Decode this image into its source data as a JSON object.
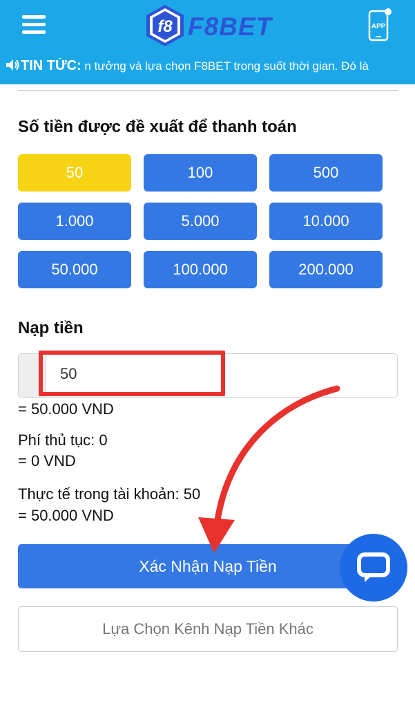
{
  "header": {
    "brand": "F8BET",
    "logo_mark": "f8",
    "app_label": "APP",
    "ticker_label": "TIN TỨC:",
    "ticker_text": " n tưởng và lựa chọn F8BET trong suốt thời gian. Đó là"
  },
  "suggested": {
    "title": "Số tiền được đề xuất để thanh toán",
    "amounts": [
      "50",
      "100",
      "500",
      "1.000",
      "5.000",
      "10.000",
      "50.000",
      "100.000",
      "200.000"
    ],
    "selected_index": 0
  },
  "deposit": {
    "title": "Nạp tiền",
    "input_value": "50",
    "converted": "= 50.000 VND",
    "fee_label": "Phí thủ tục: 0",
    "fee_converted": "= 0 VND",
    "actual_label": "Thực tế trong tài khoản: 50",
    "actual_converted": "= 50.000 VND"
  },
  "actions": {
    "confirm_label": "Xác Nhận Nạp Tiền",
    "other_label": "Lựa Chọn Kênh Nạp Tiền Khác"
  },
  "icons": {
    "menu": "hamburger-menu-icon",
    "app": "phone-app-icon",
    "speaker": "speaker-icon",
    "chat": "chat-bubble-icon"
  },
  "colors": {
    "header": "#1ca8e8",
    "button_blue": "#3478e4",
    "selected_yellow": "#f7d413",
    "annotation_red": "#e8322e",
    "chat_blue": "#1e69e6"
  }
}
